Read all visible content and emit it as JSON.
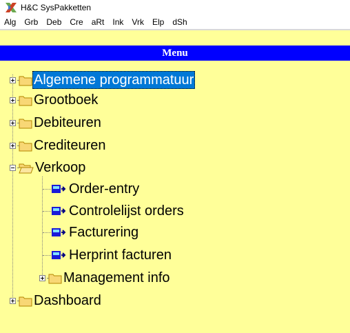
{
  "window": {
    "title": "H&C SysPakketten"
  },
  "menubar": {
    "items": [
      "Alg",
      "Grb",
      "Deb",
      "Cre",
      "aRt",
      "Ink",
      "Vrk",
      "Elp",
      "dSh"
    ]
  },
  "menu_header": "Menu",
  "tree": {
    "algemene": "Algemene programmatuur",
    "grootboek": "Grootboek",
    "debiteuren": "Debiteuren",
    "crediteuren": "Crediteuren",
    "verkoop": "Verkoop",
    "order_entry": "Order-entry",
    "controlelijst": "Controlelijst orders",
    "facturering": "Facturering",
    "herprint": "Herprint facturen",
    "management": "Management info",
    "dashboard": "Dashboard"
  },
  "colors": {
    "background": "#ffff99",
    "header": "#0000ff",
    "selected": "#0078d7"
  }
}
